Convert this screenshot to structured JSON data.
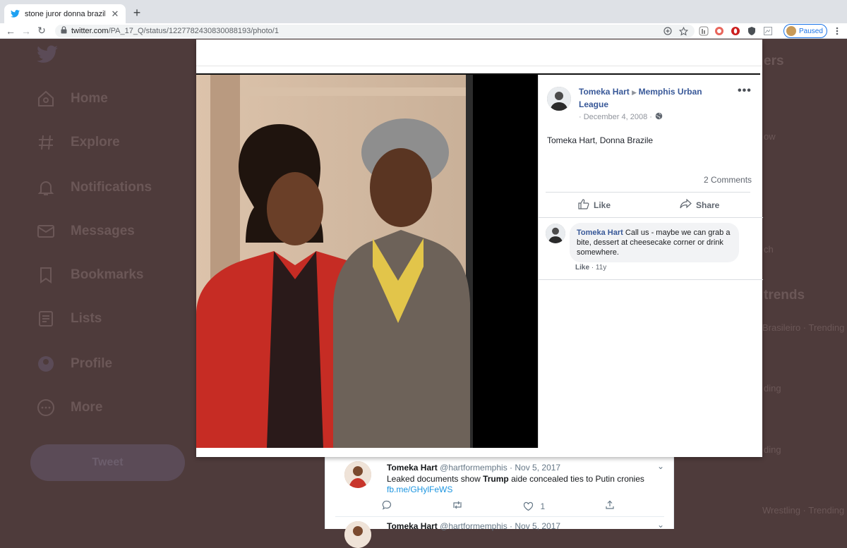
{
  "browser": {
    "tab_title": "stone juror donna brazile - Twitt",
    "url_host": "twitter.com",
    "url_path": "/PA_17_Q/status/1227782430830088193/photo/1",
    "profile_label": "Paused"
  },
  "sidebar": {
    "items": [
      {
        "label": "Home",
        "icon": "home-icon"
      },
      {
        "label": "Explore",
        "icon": "hashtag-icon"
      },
      {
        "label": "Notifications",
        "icon": "bell-icon"
      },
      {
        "label": "Messages",
        "icon": "envelope-icon"
      },
      {
        "label": "Bookmarks",
        "icon": "bookmark-icon"
      },
      {
        "label": "Lists",
        "icon": "list-icon"
      },
      {
        "label": "Profile",
        "icon": "profile-icon"
      },
      {
        "label": "More",
        "icon": "more-circle-icon"
      }
    ],
    "tweet_button": "Tweet"
  },
  "right_column_fragments": [
    "ers",
    "ow",
    "ch",
    "trends",
    "Brasileiro · Trending",
    "ding",
    "ding",
    "Wrestling · Trending"
  ],
  "facebook_post": {
    "author": "Tomeka Hart",
    "group": "Memphis Urban League",
    "date": "· December 4, 2008 ·",
    "caption": "Tomeka Hart, Donna Brazile",
    "comments_count": "2 Comments",
    "like_label": "Like",
    "share_label": "Share",
    "comment": {
      "name": "Tomeka Hart",
      "text": "Call us - maybe we can grab a bite, dessert at cheesecake corner or drink somewhere.",
      "like": "Like",
      "time": "11y"
    }
  },
  "feed": {
    "tweets": [
      {
        "name": "Tomeka Hart",
        "handle": "@hartformemphis",
        "date": "· Nov 5, 2017",
        "text_before": "Leaked documents show ",
        "text_bold": "Trump",
        "text_after": " aide concealed ties to Putin cronies",
        "link": "fb.me/GHylFeWS",
        "likes": "1"
      },
      {
        "name": "Tomeka Hart",
        "handle": "@hartformemphis",
        "date": "· Nov 5, 2017"
      }
    ]
  },
  "colors": {
    "twitter_blue": "#1da1f2",
    "facebook_link": "#385898",
    "dim_background": "#4e3b3b"
  }
}
